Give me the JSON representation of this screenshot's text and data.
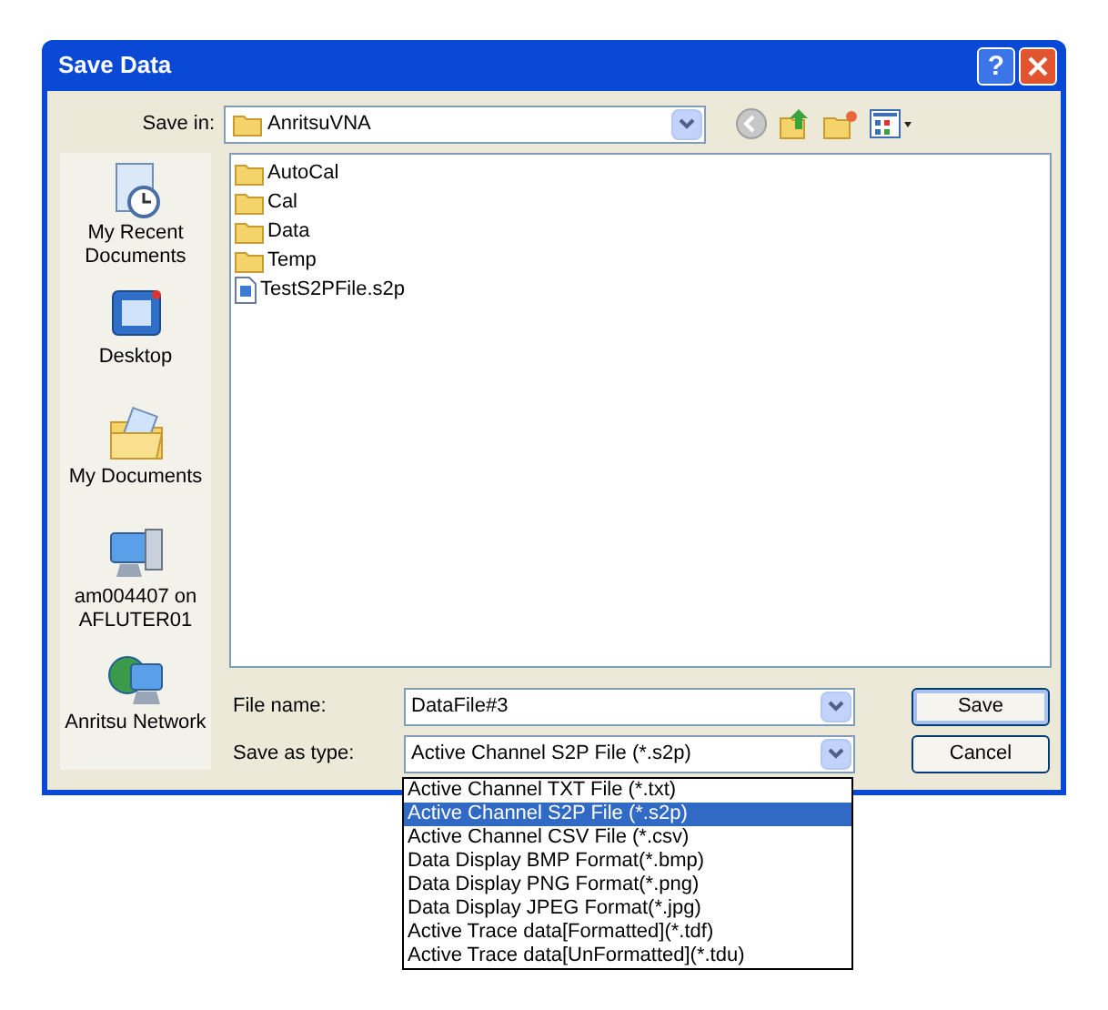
{
  "window": {
    "title": "Save Data",
    "help_button": "?"
  },
  "save_in": {
    "label": "Save in:",
    "value": "AnritsuVNA"
  },
  "places": [
    {
      "kind": "recent",
      "label": "My Recent Documents"
    },
    {
      "kind": "desktop",
      "label": "Desktop"
    },
    {
      "kind": "documents",
      "label": "My Documents"
    },
    {
      "kind": "computer",
      "label": "am004407 on AFLUTER01"
    },
    {
      "kind": "network",
      "label": "Anritsu Network"
    }
  ],
  "files": [
    {
      "kind": "folder",
      "name": "AutoCal"
    },
    {
      "kind": "folder",
      "name": "Cal"
    },
    {
      "kind": "folder",
      "name": "Data"
    },
    {
      "kind": "folder",
      "name": "Temp"
    },
    {
      "kind": "file",
      "name": "TestS2PFile.s2p"
    }
  ],
  "file_name": {
    "label": "File name:",
    "value": "DataFile#3"
  },
  "save_as_type": {
    "label": "Save as type:",
    "value": "Active Channel S2P File (*.s2p)",
    "expanded": true,
    "options": [
      {
        "label": "Active Channel TXT File (*.txt)",
        "selected": false
      },
      {
        "label": "Active Channel S2P File (*.s2p)",
        "selected": true
      },
      {
        "label": "Active Channel CSV File (*.csv)",
        "selected": false
      },
      {
        "label": "Data Display BMP Format(*.bmp)",
        "selected": false
      },
      {
        "label": "Data Display PNG Format(*.png)",
        "selected": false
      },
      {
        "label": "Data Display JPEG Format(*.jpg)",
        "selected": false
      },
      {
        "label": "Active Trace data[Formatted](*.tdf)",
        "selected": false
      },
      {
        "label": "Active Trace data[UnFormatted](*.tdu)",
        "selected": false
      }
    ]
  },
  "buttons": [
    {
      "kind": "save",
      "label": "Save"
    },
    {
      "kind": "cancel",
      "label": "Cancel"
    }
  ]
}
